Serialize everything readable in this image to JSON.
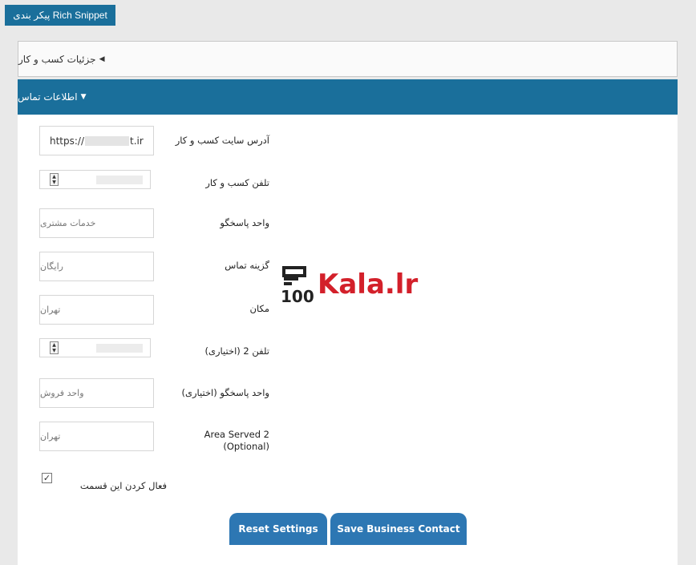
{
  "header": {
    "rich_snippet_button": "پیکر بندی Rich Snippet"
  },
  "sections": {
    "business_details": "جزئیات کسب و کار",
    "contact_info": "اطلاعات تماس"
  },
  "fields": {
    "website": {
      "label": "آدرس سایت کسب و کار",
      "value_prefix": "https://",
      "value_suffix": "t.ir"
    },
    "phone": {
      "label": "تلفن کسب و کار"
    },
    "responder": {
      "label": "واحد پاسخگو",
      "placeholder": "خدمات مشتری"
    },
    "contact_option": {
      "label": "گزینه تماس",
      "placeholder": "رایگان"
    },
    "location": {
      "label": "مکان",
      "placeholder": "تهران"
    },
    "phone2": {
      "label": "تلفن 2 (اختیاری)"
    },
    "responder2": {
      "label": "واحد پاسخگو (اختیاری)",
      "placeholder": "واحد فروش"
    },
    "area_served2": {
      "label": "Area Served 2 (Optional)",
      "placeholder": "تهران"
    }
  },
  "enable_section": {
    "label": "فعال کردن این قسمت",
    "checked": true
  },
  "buttons": {
    "reset": "Reset Settings",
    "save": "Save Business Contact"
  },
  "watermark": {
    "text": "Kala.lr",
    "mark_text": "100"
  },
  "colors": {
    "accent": "#1a6f9b",
    "button": "#2d77b3",
    "watermark": "#d3202a"
  }
}
